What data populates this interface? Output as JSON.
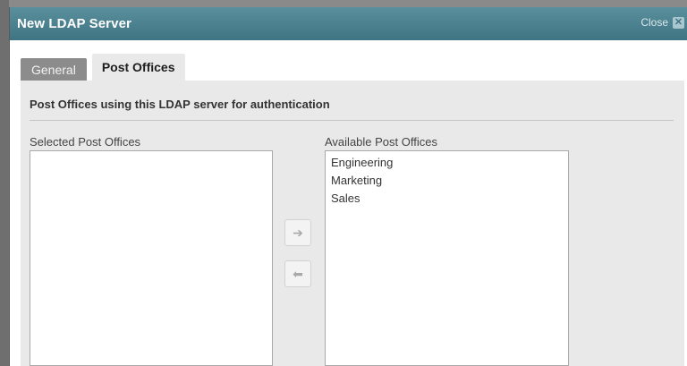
{
  "dialog": {
    "title": "New LDAP Server",
    "close_label": "Close",
    "close_glyph": "✕"
  },
  "tabs": [
    {
      "label": "General",
      "active": false
    },
    {
      "label": "Post Offices",
      "active": true
    }
  ],
  "panel": {
    "section_title": "Post Offices using this LDAP server for authentication",
    "selected": {
      "label": "Selected Post Offices",
      "items": []
    },
    "available": {
      "label": "Available Post Offices",
      "items": [
        "Engineering",
        "Marketing",
        "Sales"
      ]
    },
    "move_right_glyph": "➔",
    "move_left_glyph": "⬅"
  },
  "colors": {
    "titlebar": "#4a7f8d",
    "panel": "#e9e9e9",
    "inactive_tab": "#8c8c8c"
  }
}
